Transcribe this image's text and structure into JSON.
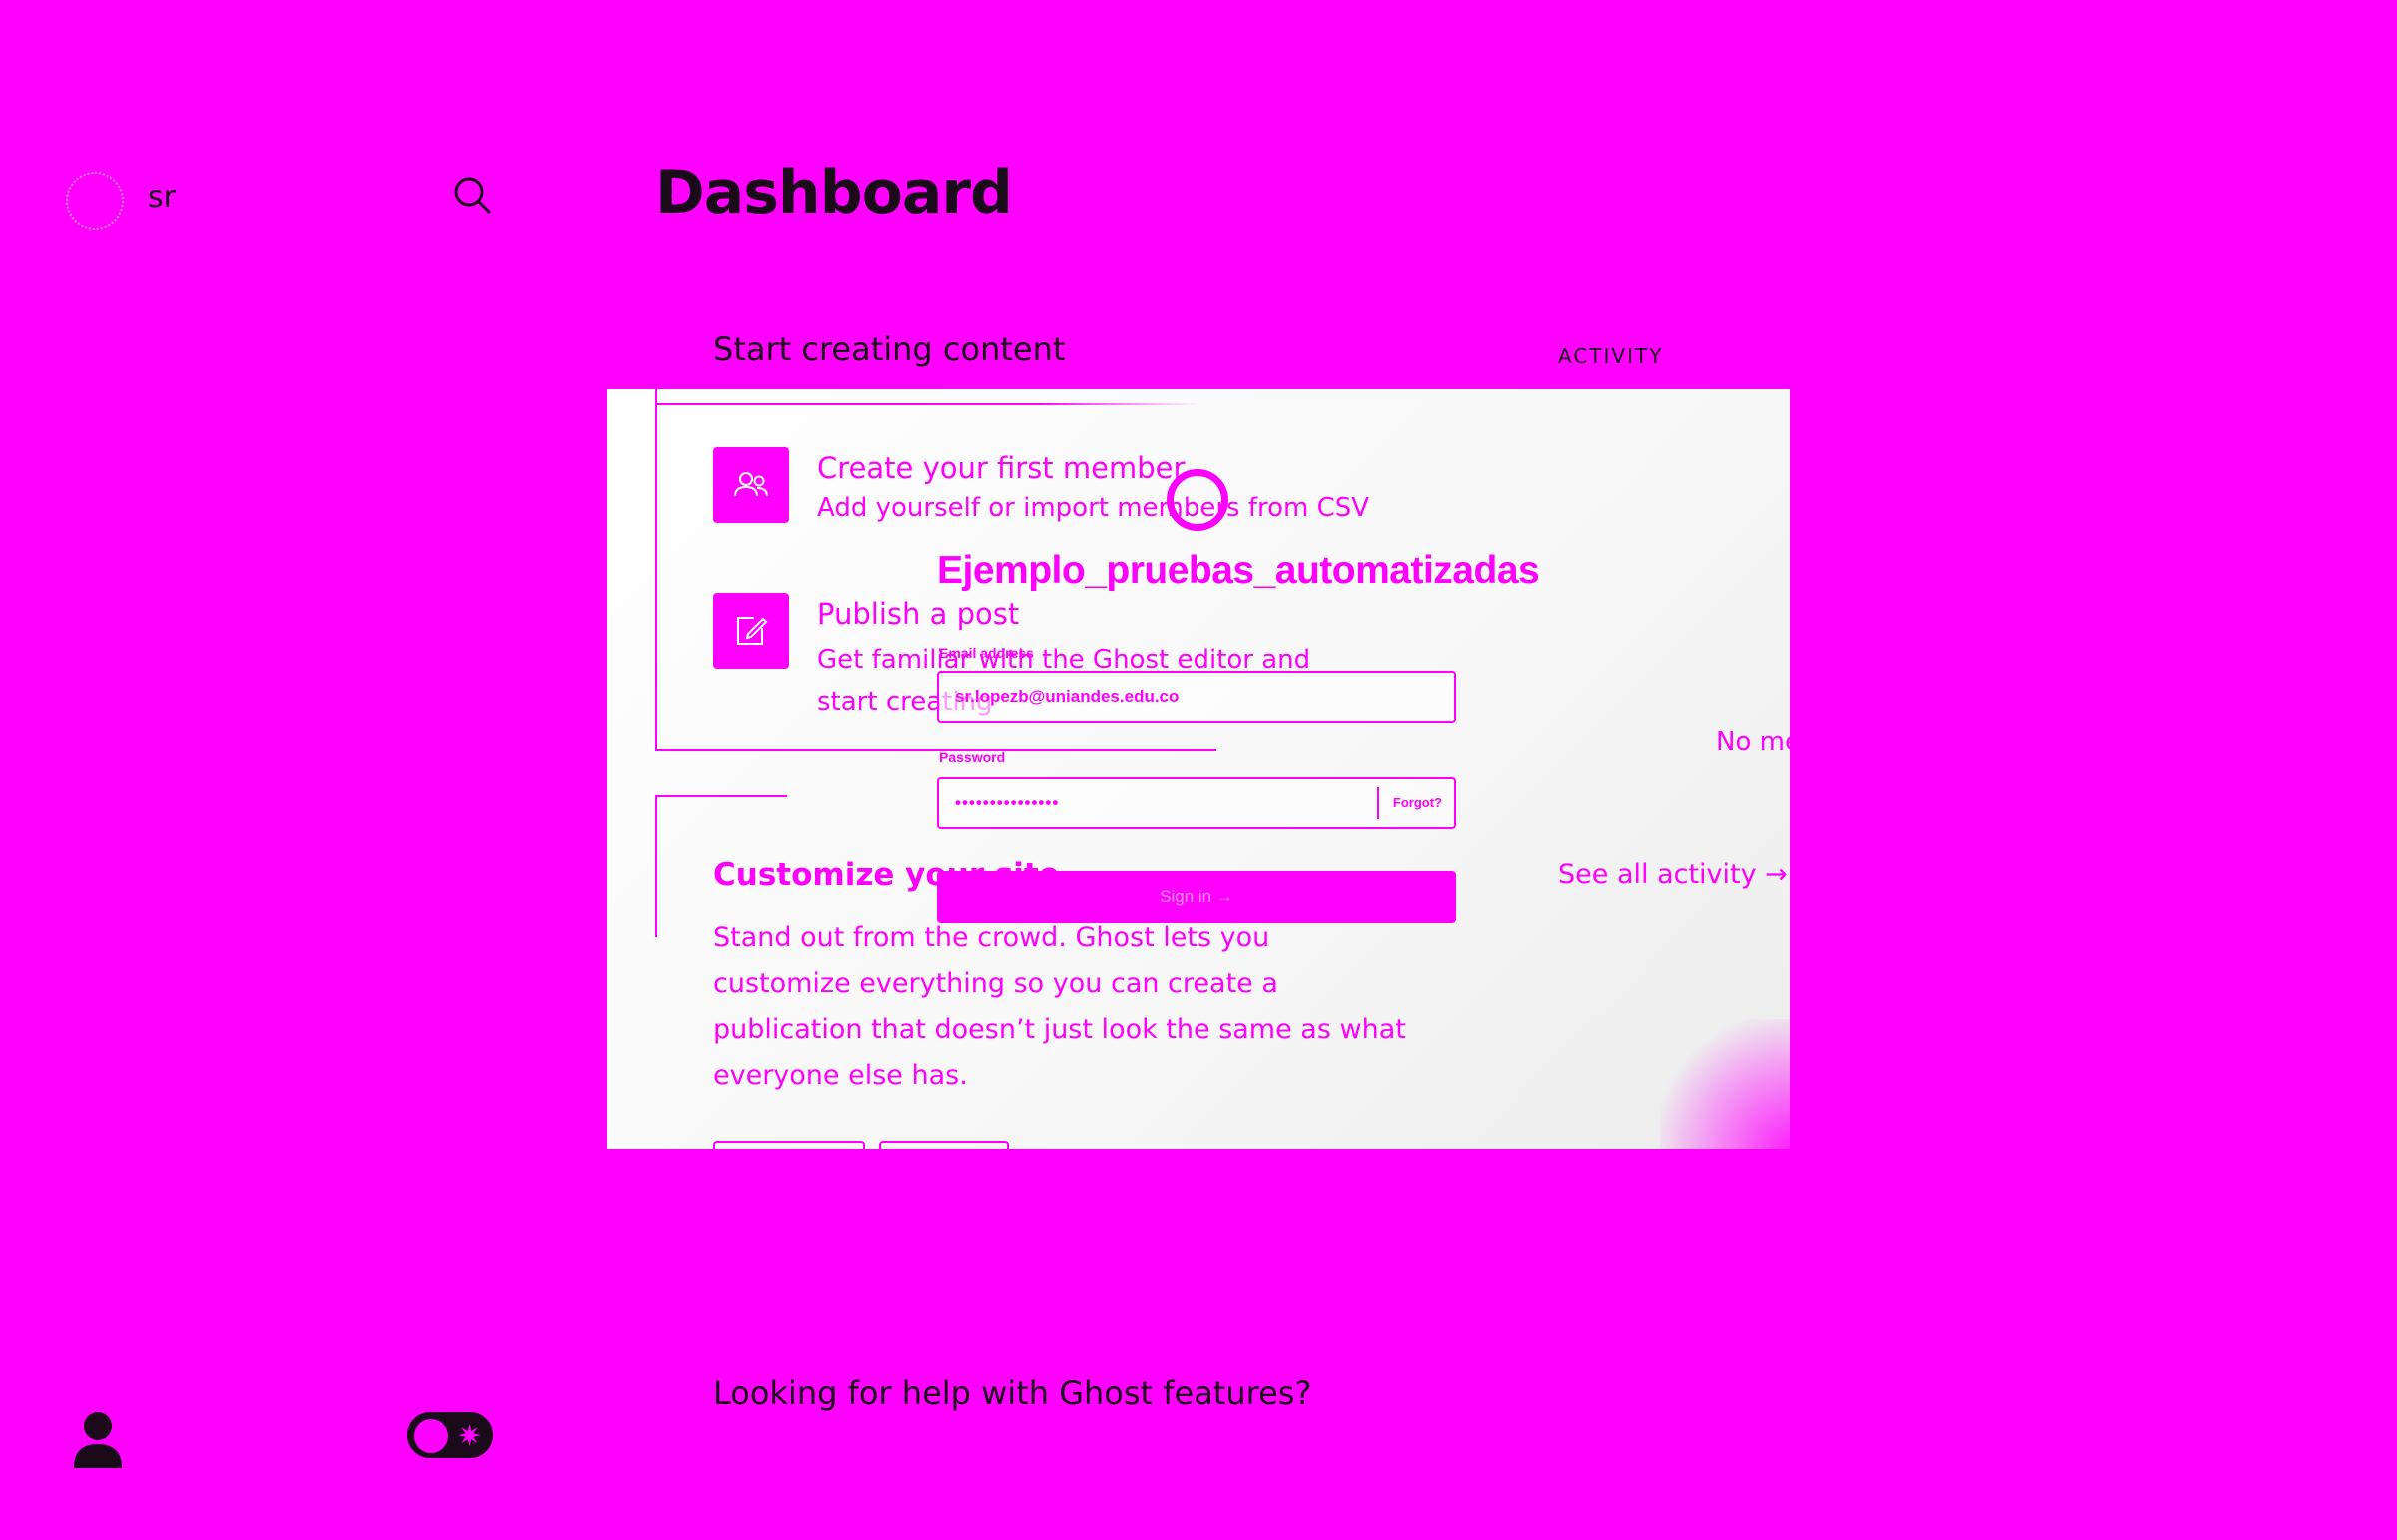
{
  "sidebar": {
    "site_name": "sr"
  },
  "header": {
    "title": "Dashboard"
  },
  "main": {
    "section_title": "Start creating content",
    "activity_title": "ACTIVITY",
    "help_title": "Looking for help with Ghost features?",
    "cards": {
      "members_title": "Create your first member",
      "members_desc": "Add yourself or import members from CSV",
      "post_title": "Publish a post",
      "post_desc": "Get familiar with the Ghost editor and start creating",
      "customize_title": "Customize your site",
      "customize_desc": "Stand out from the crowd. Ghost lets you customize everything so you can create a publication that doesn’t just look the same as what everyone else has."
    },
    "activity": {
      "empty_text": "No me",
      "see_all": "See all activity →"
    }
  },
  "login": {
    "title": "Ejemplo_pruebas_automatizadas",
    "email_label": "Email address",
    "email_value": "sr.lopezb@uniandes.edu.co",
    "password_label": "Password",
    "password_value": "•••••••••••••••",
    "forgot_label": "Forgot?",
    "signin_label": "Sign in →"
  },
  "colors": {
    "background": "#ff00ff",
    "overlay": "#ffffff",
    "text_dark": "#1a0a1a"
  }
}
